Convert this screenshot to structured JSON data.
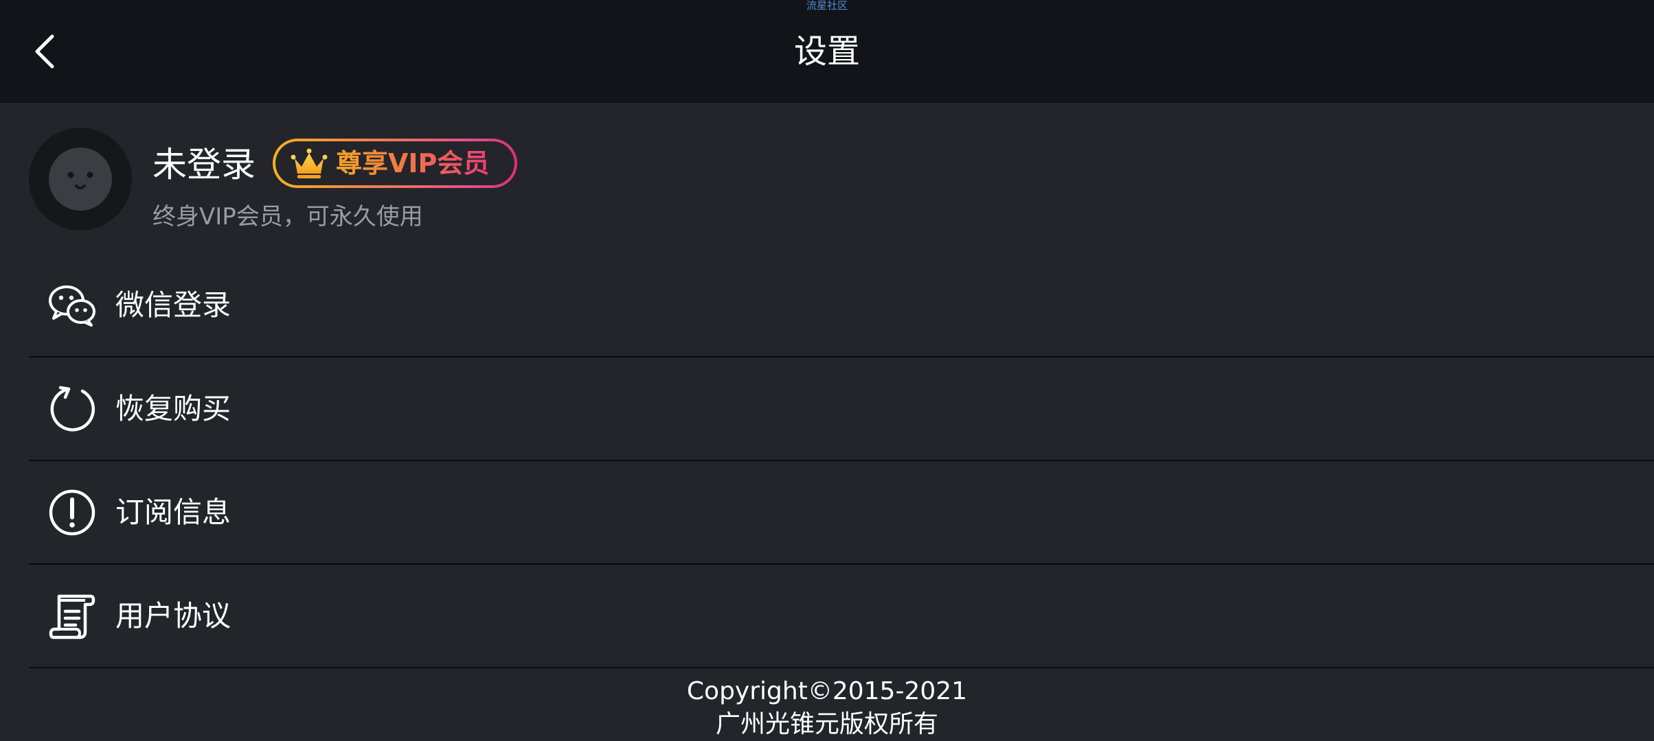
{
  "watermark": "流星社区",
  "header": {
    "title": "设置",
    "back_icon": "chevron-left-icon"
  },
  "profile": {
    "username": "未登录",
    "avatar_icon": "face-avatar-icon",
    "vip_badge": {
      "icon": "crown-icon",
      "label": "尊享VIP会员"
    },
    "vip_description": "终身VIP会员，可永久使用"
  },
  "menu": {
    "items": [
      {
        "label": "微信登录",
        "icon": "wechat-icon"
      },
      {
        "label": "恢复购买",
        "icon": "refresh-icon"
      },
      {
        "label": "订阅信息",
        "icon": "info-exclamation-icon"
      },
      {
        "label": "用户协议",
        "icon": "document-icon"
      }
    ]
  },
  "footer": {
    "copyright": "Copyright©2015-2021",
    "company": "广州光锥元版权所有"
  },
  "colors": {
    "header_bg": "#131419",
    "body_bg": "#23252b",
    "vip_gradient_start": "#f6a623",
    "vip_gradient_end": "#ee3d74",
    "divider": "#0c0c0f",
    "secondary_text": "#9a9ca3"
  }
}
